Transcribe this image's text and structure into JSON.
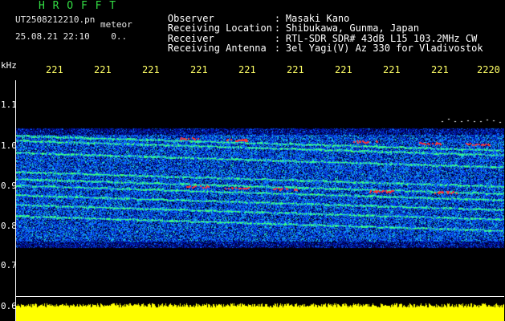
{
  "header": {
    "app_title": "H R O F F T",
    "filename": "UT2508212210.pn",
    "meteor_label": "meteor",
    "datetime": "25.08.21 22:10    0..",
    "info": [
      {
        "label": "Observer",
        "value": "Masaki Kano"
      },
      {
        "label": "Receiving Location",
        "value": "Shibukawa, Gunma, Japan"
      },
      {
        "label": "Receiver",
        "value": "RTL-SDR SDR# 43dB L15 103.2MHz CW"
      },
      {
        "label": "Receiving Antenna",
        "value": "3el Yagi(V) Az 330 for Vladivostok"
      }
    ]
  },
  "axes": {
    "y_unit": "kHz",
    "x_ticks": [
      "221",
      "221",
      "221",
      "221",
      "221",
      "221",
      "221",
      "221",
      "221",
      "2220"
    ],
    "y_ticks": [
      "1.1",
      "1.0",
      "0.9",
      "0.8",
      "0.7",
      "0.6"
    ]
  },
  "colors": {
    "background": "#000000",
    "title_green": "#33dd44",
    "tick_yellow": "#ffff66",
    "level_yellow": "#ffff00",
    "noise_blue": "#0a2aff",
    "signal_green": "#33ff66",
    "signal_red": "#ff3333"
  }
}
